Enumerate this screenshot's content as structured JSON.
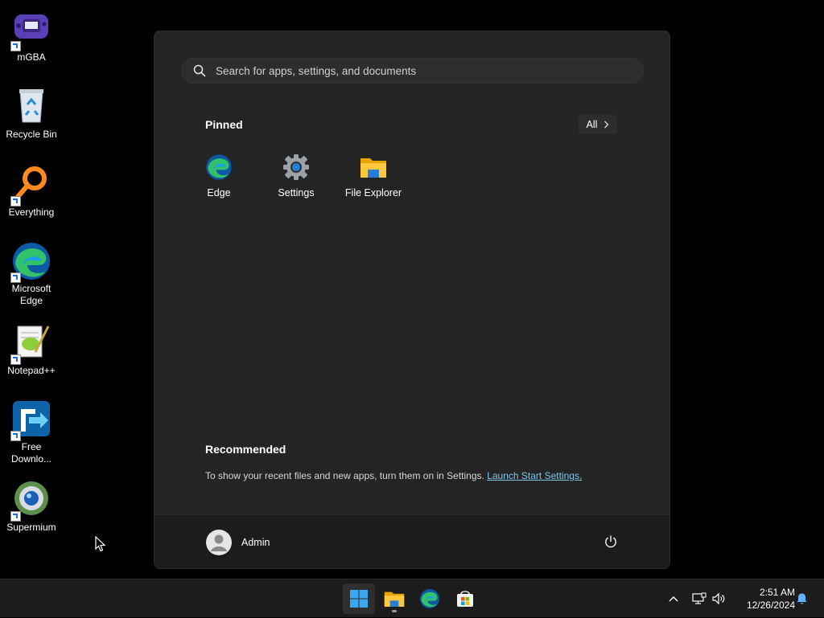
{
  "desktop": {
    "icons": [
      {
        "label": "mGBA"
      },
      {
        "label": "Recycle Bin"
      },
      {
        "label": "Everything"
      },
      {
        "label": "Microsoft Edge"
      },
      {
        "label": "Notepad++"
      },
      {
        "label": "Free Downlo..."
      },
      {
        "label": "Supermium"
      }
    ]
  },
  "start_menu": {
    "search": {
      "placeholder": "Search for apps, settings, and documents"
    },
    "pinned": {
      "title": "Pinned",
      "all_label": "All",
      "apps": [
        {
          "label": "Edge",
          "icon": "edge-icon"
        },
        {
          "label": "Settings",
          "icon": "gear-icon"
        },
        {
          "label": "File Explorer",
          "icon": "folder-icon"
        }
      ]
    },
    "recommended": {
      "title": "Recommended",
      "text": "To show your recent files and new apps, turn them on in Settings.",
      "link": "Launch Start Settings."
    },
    "user": {
      "name": "Admin"
    }
  },
  "taskbar": {
    "clock": {
      "time": "2:51 AM",
      "date": "12/26/2024"
    }
  },
  "colors": {
    "accent": "#0078d4",
    "link": "#7fc7e8",
    "menu_bg": "#242424"
  }
}
